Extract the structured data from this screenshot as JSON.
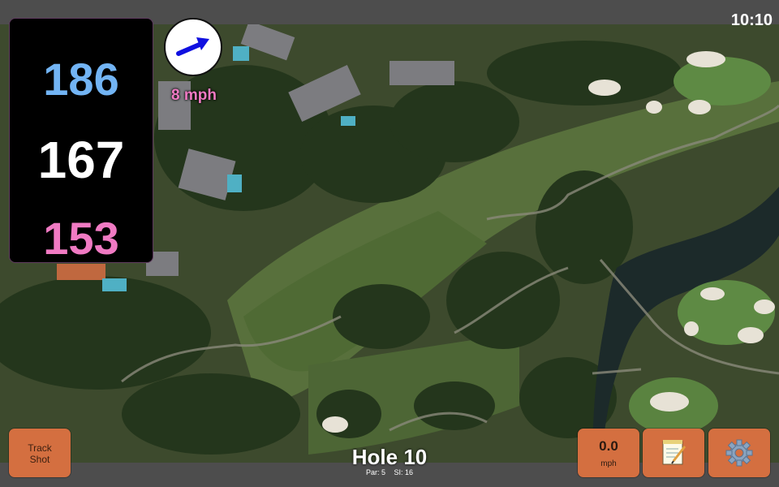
{
  "status": {
    "time": "10:10"
  },
  "distances": {
    "back": "186",
    "middle": "167",
    "front": "153"
  },
  "wind": {
    "speed_label": "8 mph",
    "direction_icon": "arrow-northeast-icon"
  },
  "hole": {
    "title": "Hole 10",
    "par": "Par: 5",
    "stroke_index": "SI: 16"
  },
  "buttons": {
    "track_line1": "Track",
    "track_line2": "Shot",
    "wind_value": "0.0",
    "wind_unit": "mph",
    "notes_icon": "notepad-icon",
    "settings_icon": "gear-icon"
  },
  "colors": {
    "back_distance": "#72b4f4",
    "middle_distance": "#ffffff",
    "front_distance": "#f07ac3",
    "button_bg": "#d46f40",
    "wind_label": "#f07ac3"
  }
}
